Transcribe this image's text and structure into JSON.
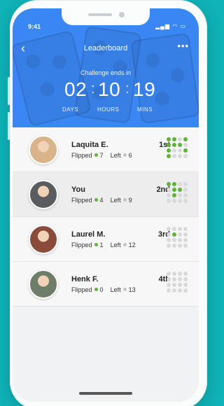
{
  "status": {
    "time": "9:41",
    "icons": "▂▄▆ ◠ ▭"
  },
  "nav": {
    "back_icon": "‹",
    "title": "Leaderboard",
    "more_icon": "•••"
  },
  "challenge": {
    "label": "Challenge ends in",
    "days": "02",
    "hours": "10",
    "mins": "19",
    "separator": ":",
    "days_label": "DAYS",
    "hours_label": "HOURS",
    "mins_label": "MINS"
  },
  "leaderboard": [
    {
      "name": "Laquita E.",
      "rank": "1st",
      "flipped_label": "Flipped",
      "flipped": "7",
      "left_label": "Left",
      "left": "6",
      "avatar_color": "#d9b48a",
      "grid": [
        1,
        1,
        0,
        1,
        1,
        1,
        1,
        0,
        1,
        0,
        0,
        1,
        1,
        0,
        0,
        0
      ]
    },
    {
      "name": "You",
      "rank": "2nd",
      "flipped_label": "Flipped",
      "flipped": "4",
      "left_label": "Left",
      "left": "9",
      "avatar_color": "#5a5c60",
      "grid": [
        1,
        1,
        0,
        0,
        0,
        1,
        1,
        0,
        0,
        1,
        0,
        0,
        0,
        0,
        0,
        0
      ]
    },
    {
      "name": "Laurel M.",
      "rank": "3rd",
      "flipped_label": "Flipped",
      "flipped": "1",
      "left_label": "Left",
      "left": "12",
      "avatar_color": "#8a4b3a",
      "grid": [
        0,
        0,
        0,
        0,
        0,
        1,
        0,
        0,
        0,
        0,
        0,
        0,
        0,
        0,
        0,
        0
      ]
    },
    {
      "name": "Henk F.",
      "rank": "4th",
      "flipped_label": "Flipped",
      "flipped": "0",
      "left_label": "Left",
      "left": "13",
      "avatar_color": "#6e7d6a",
      "grid": [
        0,
        0,
        0,
        0,
        0,
        0,
        0,
        0,
        0,
        0,
        0,
        0,
        0,
        0,
        0,
        0
      ]
    }
  ],
  "colors": {
    "header": "#3a86f2",
    "flipped_dot": "#5fb33a",
    "left_dot": "#c3c6c9",
    "background": "#0fb3b8"
  }
}
